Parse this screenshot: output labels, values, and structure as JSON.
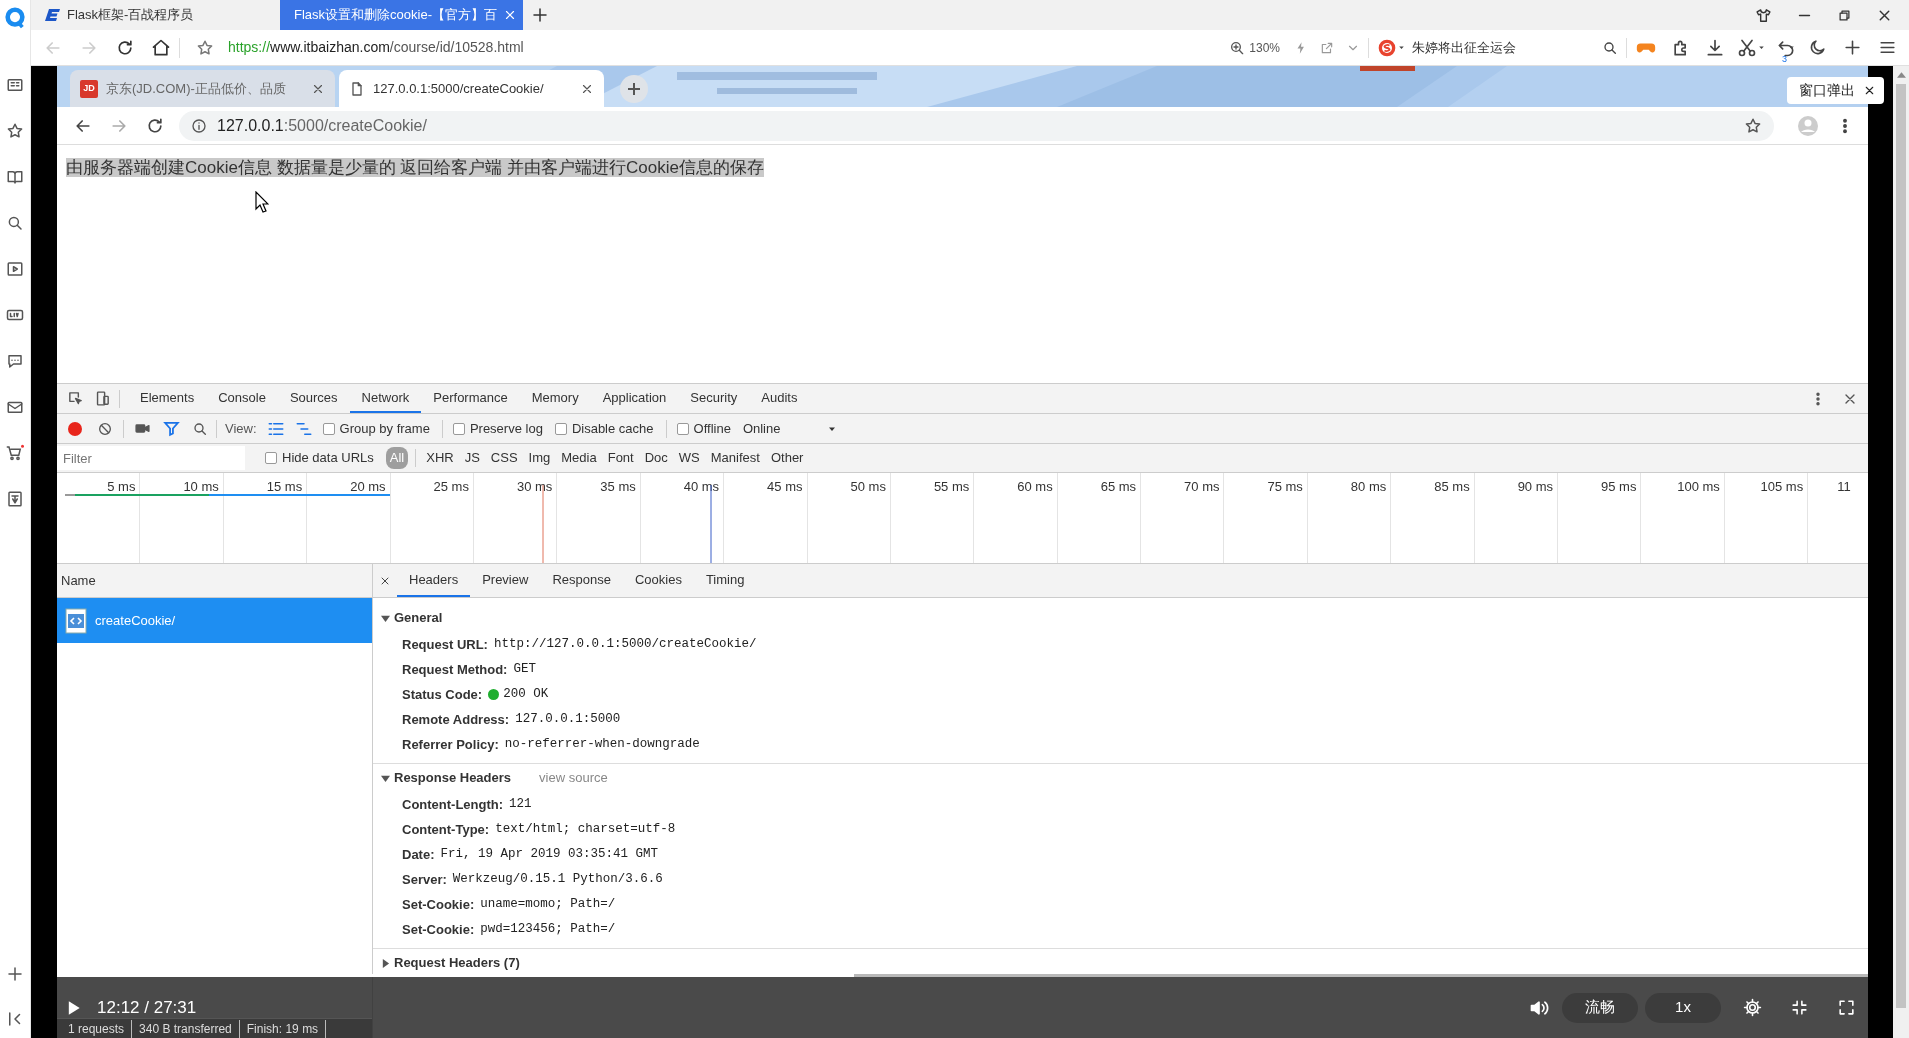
{
  "browser": {
    "tabs": [
      {
        "title": "Flask框架-百战程序员",
        "selected": false
      },
      {
        "title": "Flask设置和删除cookie-【官方】百",
        "selected": true
      }
    ],
    "url": {
      "scheme": "https://",
      "host": "www.itbaizhan.com",
      "path": "/course/id/10528.html"
    },
    "zoom": "130%",
    "search_hint": "朱婷将出征全运会",
    "undo_count": "3"
  },
  "inner_browser": {
    "tabs": [
      {
        "favicon": "JD",
        "title": "京东(JD.COM)-正品低价、品质",
        "selected": false
      },
      {
        "title": "127.0.0.1:5000/createCookie/",
        "selected": true
      }
    ],
    "url": {
      "host": "127.0.0.1",
      "rest": ":5000/createCookie/"
    }
  },
  "popup": {
    "label": "窗口弹出"
  },
  "page": {
    "text": "由服务器端创建Cookie信息 数据量是少量的 返回给客户端 并由客户端进行Cookie信息的保存",
    "selected": true
  },
  "devtools": {
    "tabs": [
      {
        "label": "Elements",
        "selected": false
      },
      {
        "label": "Console",
        "selected": false
      },
      {
        "label": "Sources",
        "selected": false
      },
      {
        "label": "Network",
        "selected": true
      },
      {
        "label": "Performance",
        "selected": false
      },
      {
        "label": "Memory",
        "selected": false
      },
      {
        "label": "Application",
        "selected": false
      },
      {
        "label": "Security",
        "selected": false
      },
      {
        "label": "Audits",
        "selected": false
      }
    ],
    "recording": true,
    "filter_on": true,
    "view_label": "View:",
    "view_modes": [
      {
        "kind": "list",
        "on": true
      },
      {
        "kind": "overview",
        "on": true
      }
    ],
    "options": [
      {
        "label": "Group by frame",
        "checked": false
      },
      {
        "label": "Preserve log",
        "checked": false
      },
      {
        "label": "Disable cache",
        "checked": false
      },
      {
        "label": "Offline",
        "checked": false
      }
    ],
    "throttling": "Online",
    "filter": {
      "placeholder": "Filter"
    },
    "hide_data_urls": {
      "label": "Hide data URLs",
      "checked": false
    },
    "types": [
      {
        "label": "All",
        "selected": true
      },
      {
        "label": "XHR",
        "selected": false
      },
      {
        "label": "JS",
        "selected": false
      },
      {
        "label": "CSS",
        "selected": false
      },
      {
        "label": "Img",
        "selected": false
      },
      {
        "label": "Media",
        "selected": false
      },
      {
        "label": "Font",
        "selected": false
      },
      {
        "label": "Doc",
        "selected": false
      },
      {
        "label": "WS",
        "selected": false
      },
      {
        "label": "Manifest",
        "selected": false
      },
      {
        "label": "Other",
        "selected": false
      }
    ],
    "ticks": [
      "5 ms",
      "10 ms",
      "15 ms",
      "20 ms",
      "25 ms",
      "30 ms",
      "35 ms",
      "40 ms",
      "45 ms",
      "50 ms",
      "55 ms",
      "60 ms",
      "65 ms",
      "70 ms",
      "75 ms",
      "80 ms",
      "85 ms",
      "90 ms",
      "95 ms",
      "100 ms",
      "105 ms",
      "11"
    ],
    "requests": {
      "column": "Name",
      "rows": [
        {
          "name": "createCookie/",
          "selected": true
        }
      ]
    },
    "detail_tabs": [
      {
        "label": "Headers",
        "selected": true
      },
      {
        "label": "Preview",
        "selected": false
      },
      {
        "label": "Response",
        "selected": false
      },
      {
        "label": "Cookies",
        "selected": false
      },
      {
        "label": "Timing",
        "selected": false
      }
    ],
    "sections": [
      {
        "title": "General",
        "expanded": true,
        "rows": [
          {
            "kind": "plain",
            "key": "Request URL:",
            "value": "http://127.0.0.1:5000/createCookie/"
          },
          {
            "kind": "plain",
            "key": "Request Method:",
            "value": "GET"
          },
          {
            "kind": "status",
            "key": "Status Code:",
            "value": "200 OK"
          },
          {
            "kind": "plain",
            "key": "Remote Address:",
            "value": "127.0.0.1:5000"
          },
          {
            "kind": "plain",
            "key": "Referrer Policy:",
            "value": "no-referrer-when-downgrade"
          }
        ]
      },
      {
        "title": "Response Headers",
        "expanded": true,
        "link": "view source",
        "rows": [
          {
            "kind": "plain",
            "key": "Content-Length:",
            "value": "121"
          },
          {
            "kind": "plain",
            "key": "Content-Type:",
            "value": "text/html; charset=utf-8"
          },
          {
            "kind": "plain",
            "key": "Date:",
            "value": "Fri, 19 Apr 2019 03:35:41 GMT"
          },
          {
            "kind": "plain",
            "key": "Server:",
            "value": "Werkzeug/0.15.1 Python/3.6.6"
          },
          {
            "kind": "plain",
            "key": "Set-Cookie:",
            "value": "uname=momo; Path=/"
          },
          {
            "kind": "plain",
            "key": "Set-Cookie:",
            "value": "pwd=123456; Path=/"
          }
        ]
      },
      {
        "title": "Request Headers (7)",
        "expanded": false
      }
    ],
    "status": [
      "1 requests",
      "340 B transferred",
      "Finish: 19 ms"
    ]
  },
  "player": {
    "time": "12:12 / 27:31",
    "level": 0.44,
    "quality": "流畅",
    "speed": "1x"
  }
}
